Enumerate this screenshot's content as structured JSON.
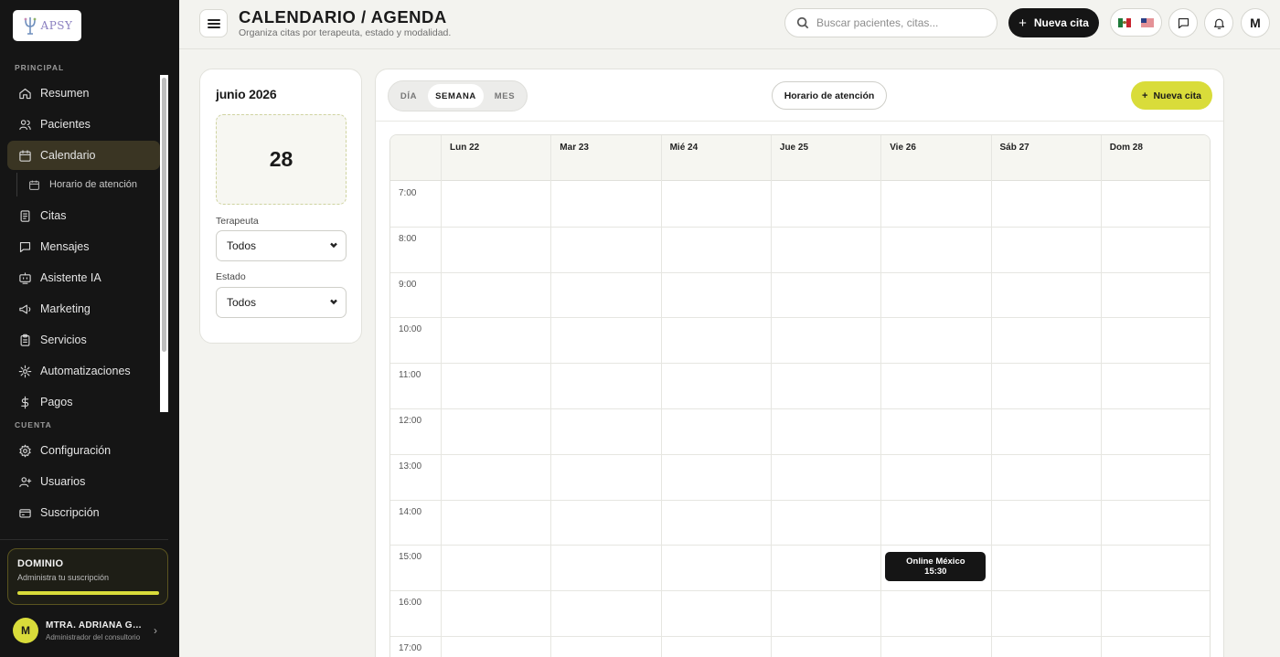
{
  "app": {
    "logo_text": "APSY"
  },
  "sidebar": {
    "section_principal": "PRINCIPAL",
    "section_cuenta": "CUENTA",
    "items": [
      {
        "label": "Resumen",
        "icon": "home-icon"
      },
      {
        "label": "Pacientes",
        "icon": "users-icon"
      },
      {
        "label": "Calendario",
        "icon": "calendar-icon",
        "active": true
      },
      {
        "label": "Citas",
        "icon": "clipboard-icon"
      },
      {
        "label": "Mensajes",
        "icon": "message-icon"
      },
      {
        "label": "Asistente IA",
        "icon": "bot-icon"
      },
      {
        "label": "Marketing",
        "icon": "megaphone-icon"
      },
      {
        "label": "Servicios",
        "icon": "clipboard-list-icon"
      },
      {
        "label": "Automatizaciones",
        "icon": "sparkle-icon"
      },
      {
        "label": "Pagos",
        "icon": "dollar-icon"
      }
    ],
    "sub_item": {
      "label": "Horario de atención",
      "icon": "calendar-icon"
    },
    "account_items": [
      {
        "label": "Configuración",
        "icon": "gear-icon"
      },
      {
        "label": "Usuarios",
        "icon": "user-plus-icon"
      },
      {
        "label": "Suscripción",
        "icon": "credit-card-icon"
      }
    ],
    "plan": {
      "title": "DOMINIO",
      "subtitle": "Administra tu suscripción",
      "progress": 1.0
    },
    "user": {
      "initial": "M",
      "name": "MTRA. ADRIANA GUADALUPE",
      "role": "Administrador del consultorio"
    }
  },
  "header": {
    "title": "CALENDARIO / AGENDA",
    "subtitle": "Organiza citas por terapeuta, estado y modalidad.",
    "search_placeholder": "Buscar pacientes, citas...",
    "new_button": "Nueva cita",
    "avatar_initial": "M"
  },
  "filters": {
    "month_label": "junio 2026",
    "selected_day": "28",
    "therapist_label": "Terapeuta",
    "therapist_value": "Todos",
    "status_label": "Estado",
    "status_value": "Todos"
  },
  "calendar": {
    "tabs": [
      "DÍA",
      "SEMANA",
      "MES"
    ],
    "active_tab": "SEMANA",
    "hours_button": "Horario de atención",
    "new_button": "Nueva cita",
    "days": [
      "Lun 22",
      "Mar 23",
      "Mié 24",
      "Jue 25",
      "Vie 26",
      "Sáb 27",
      "Dom 28"
    ],
    "hours": [
      "7:00",
      "8:00",
      "9:00",
      "10:00",
      "11:00",
      "12:00",
      "13:00",
      "14:00",
      "15:00",
      "16:00",
      "17:00"
    ],
    "events": [
      {
        "day": "Vie 26",
        "start": "15:00",
        "title": "Online México",
        "time": "15:30"
      }
    ]
  },
  "colors": {
    "accent": "#d9dc3a",
    "sidebar_bg": "#151515",
    "active_item_bg": "#3a3523",
    "page_bg": "#f3f3ef"
  }
}
